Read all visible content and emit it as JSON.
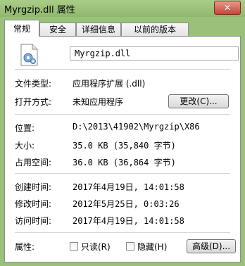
{
  "window": {
    "title": "Myrgzip.dll 属性",
    "close_label": "✕"
  },
  "tabs": [
    {
      "label": "常规"
    },
    {
      "label": "安全"
    },
    {
      "label": "详细信息"
    },
    {
      "label": "以前的版本"
    }
  ],
  "file": {
    "icon": "dll-file-gear-icon",
    "name": "Myrgzip.dll"
  },
  "type_section": {
    "type_label": "文件类型:",
    "type_value": "应用程序扩展 (.dll)",
    "open_with_label": "打开方式:",
    "open_with_value": "未知应用程序",
    "change_button": "更改(C)..."
  },
  "location_section": {
    "location_label": "位置:",
    "location_value": "D:\\2013\\41902\\Myrgzip\\X86",
    "size_label": "大小:",
    "size_value": "35.0 KB (35,840 字节)",
    "disk_size_label": "占用空间:",
    "disk_size_value": "36.0 KB (36,864 字节)"
  },
  "dates_section": {
    "created_label": "创建时间:",
    "created_value": "2017年4月19日, 14:01:58",
    "modified_label": "修改时间:",
    "modified_value": "2012年5月25日, 0:03:26",
    "accessed_label": "访问时间:",
    "accessed_value": "2017年4月19日, 14:01:58"
  },
  "attributes": {
    "label": "属性:",
    "readonly_label": "只读(R)",
    "readonly_checked": false,
    "hidden_label": "隐藏(H)",
    "hidden_checked": false,
    "advanced_button": "高级(D)..."
  }
}
